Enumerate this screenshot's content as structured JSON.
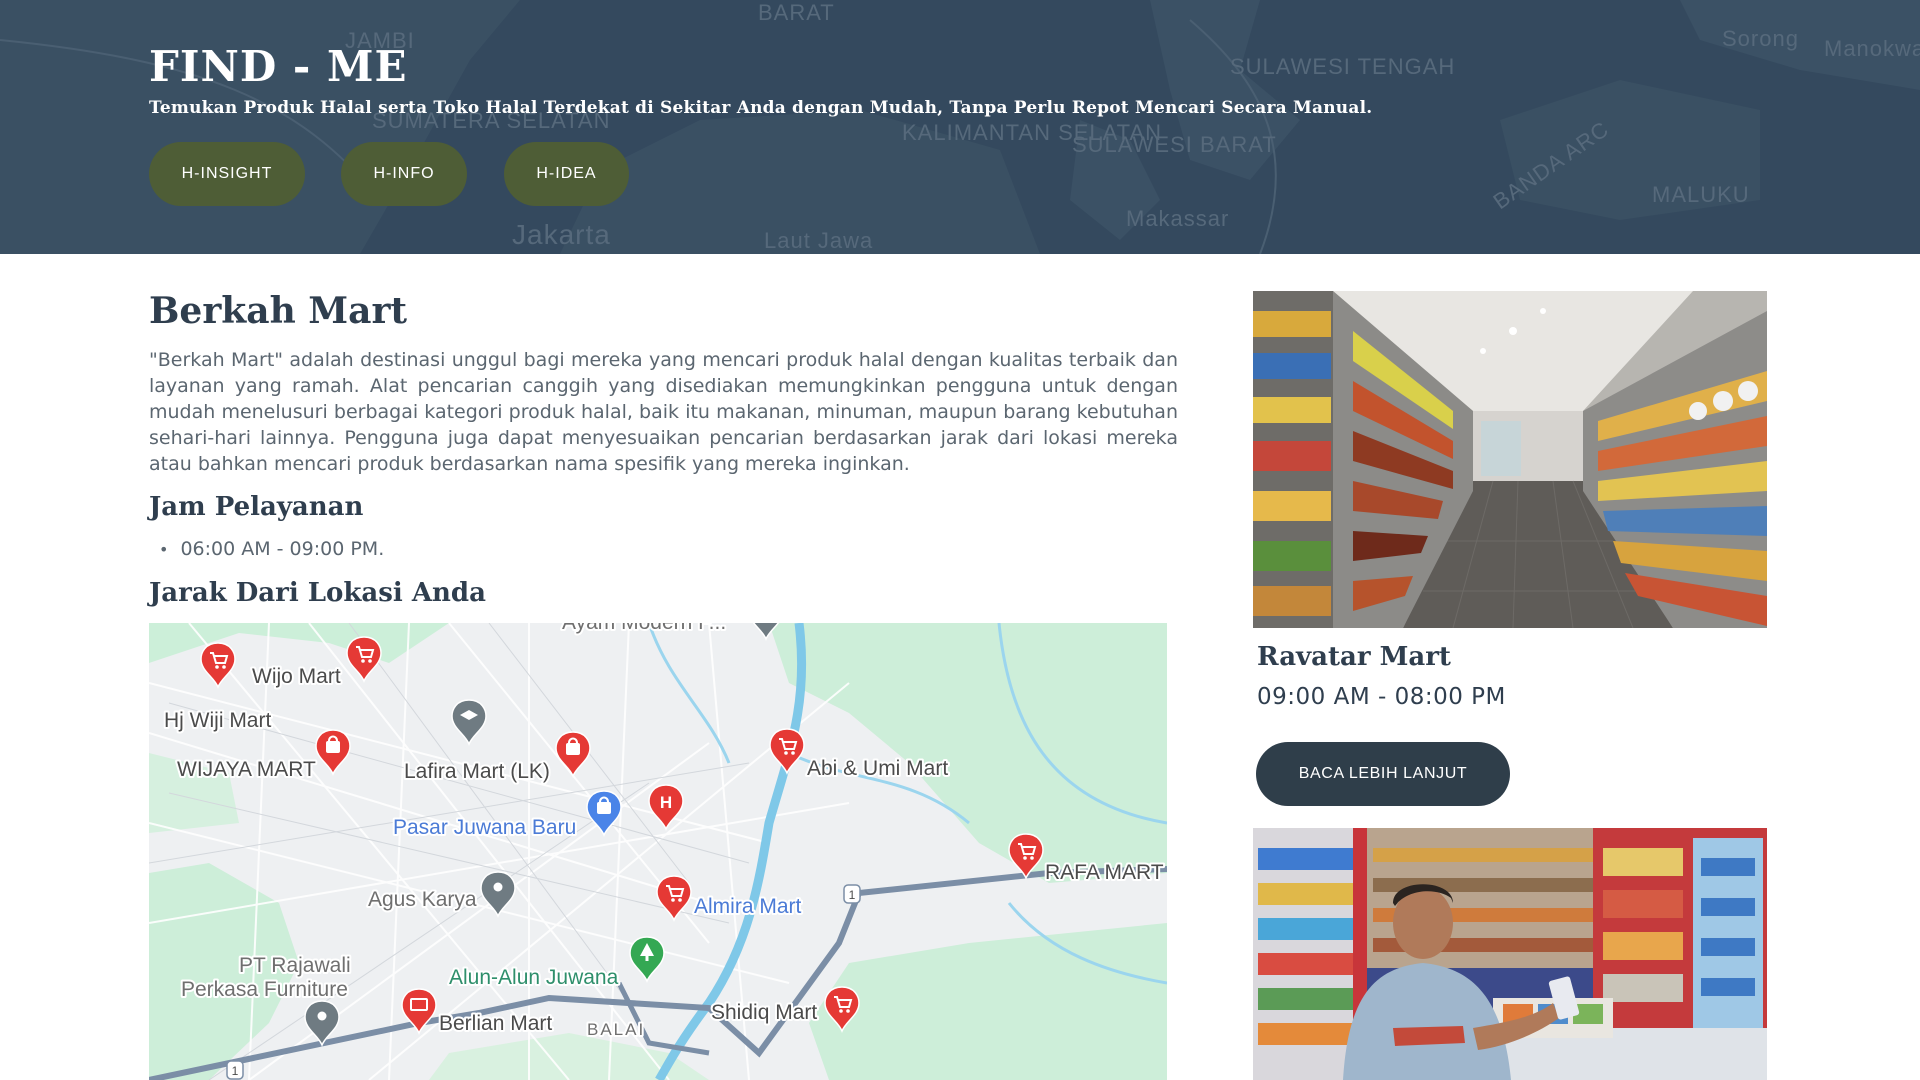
{
  "header": {
    "title": "FIND - ME",
    "subtitle": "Temukan Produk Halal serta Toko Halal Terdekat di Sekitar Anda dengan Mudah, Tanpa Perlu Repot Mencari Secara Manual.",
    "nav": [
      {
        "label": "H-INSIGHT"
      },
      {
        "label": "H-INFO"
      },
      {
        "label": "H-IDEA"
      }
    ],
    "map_labels": [
      "JAMBI",
      "BARAT",
      "SUMATERA SELATAN",
      "SULAWESI TENGAH",
      "KALIMANTAN SELATAN",
      "SULAWESI BARAT",
      "Sorong",
      "Manokwa",
      "BANDA ARC",
      "MALUKU",
      "Makassar",
      "Jakarta",
      "Laut Jawa"
    ]
  },
  "store": {
    "name": "Berkah Mart",
    "description": "\"Berkah Mart\" adalah destinasi unggul bagi mereka yang mencari produk halal dengan kualitas terbaik dan layanan yang ramah. Alat pencarian canggih yang disediakan memungkinkan pengguna untuk dengan mudah menelusuri berbagai kategori produk halal, baik itu makanan, minuman, maupun barang kebutuhan sehari-hari lainnya. Pengguna juga dapat menyesuaikan pencarian berdasarkan jarak dari lokasi mereka atau bahkan mencari produk berdasarkan nama spesifik yang mereka inginkan.",
    "hours_heading": "Jam Pelayanan",
    "hours": [
      "06:00 AM - 09:00 PM."
    ],
    "distance_heading": "Jarak Dari Lokasi Anda"
  },
  "map": {
    "places": [
      {
        "name": "Ayam Modern F...",
        "icon": "pin-icon"
      },
      {
        "name": "Wijo Mart",
        "icon": "cart-icon"
      },
      {
        "name": "Hj Wiji Mart",
        "icon": "cart-icon"
      },
      {
        "name": "WIJAYA MART",
        "icon": "shopping-bag-icon"
      },
      {
        "name": "Lafira Mart (LK)",
        "icon": "shopping-bag-icon"
      },
      {
        "name": "Abi & Umi Mart",
        "icon": "cart-icon"
      },
      {
        "name": "Pasar Juwana Baru",
        "icon": "shopping-bag-icon"
      },
      {
        "name": "RAFA MART",
        "icon": "cart-icon"
      },
      {
        "name": "Agus Karya",
        "icon": "pin-icon"
      },
      {
        "name": "Almira Mart",
        "icon": "cart-icon"
      },
      {
        "name": "PT Rajawali Perkasa Furniture",
        "icon": "pin-icon"
      },
      {
        "name": "Alun-Alun Juwana",
        "icon": "tree-icon"
      },
      {
        "name": "Shidiq Mart",
        "icon": "cart-icon"
      },
      {
        "name": "Berlian Mart",
        "icon": "store-icon"
      },
      {
        "name": "BALAI",
        "icon": ""
      }
    ],
    "hospital_marker": "H",
    "road_shield": "1"
  },
  "sidebar": {
    "card_title": "Ravatar Mart",
    "card_hours": "09:00 AM - 08:00 PM",
    "read_more": "BACA LEBIH LANJUT"
  },
  "colors": {
    "hero_overlay": "#34495e",
    "nav_button": "#4e5d36",
    "read_more_button": "#2f3e4a",
    "heading": "#2f3e4e",
    "marker_red": "#e53935"
  }
}
